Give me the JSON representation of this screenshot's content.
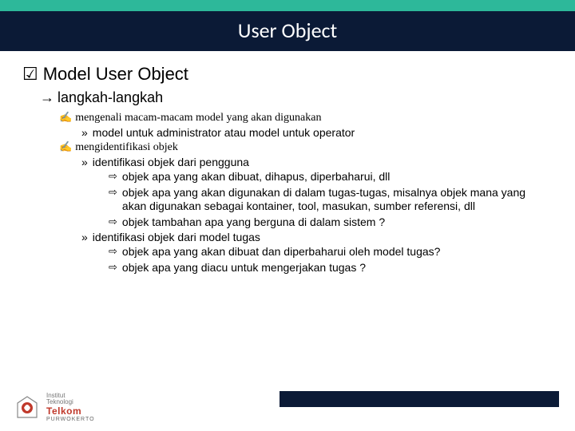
{
  "title": "User Object",
  "l1": {
    "bullet": "☑",
    "text": "Model User Object"
  },
  "l2": {
    "bullet": "→",
    "text": "langkah-langkah"
  },
  "items3": [
    {
      "bullet": "✍",
      "text": "mengenali macam-macam model yang akan digunakan",
      "children4": [
        {
          "bullet": "»",
          "text": "model untuk administrator atau model untuk operator",
          "children5": []
        }
      ]
    },
    {
      "bullet": "✍",
      "text": "mengidentifikasi objek",
      "children4": [
        {
          "bullet": "»",
          "text": "identifikasi objek dari pengguna",
          "children5": [
            {
              "bullet": "⇨",
              "text": "objek apa yang akan dibuat, dihapus, diperbaharui, dll"
            },
            {
              "bullet": "⇨",
              "text": "objek apa yang akan digunakan di dalam tugas-tugas, misalnya objek mana yang akan digunakan sebagai kontainer, tool, masukan, sumber referensi, dll"
            },
            {
              "bullet": "⇨",
              "text": "objek tambahan apa yang berguna di dalam sistem ?"
            }
          ]
        },
        {
          "bullet": "»",
          "text": "identifikasi objek dari model tugas",
          "children5": [
            {
              "bullet": "⇨",
              "text": "objek apa yang akan dibuat dan diperbaharui oleh model tugas?"
            },
            {
              "bullet": "⇨",
              "text": "objek apa yang diacu untuk mengerjakan tugas ?"
            }
          ]
        }
      ]
    }
  ],
  "logo": {
    "inst": "Institut",
    "tech": "Teknologi",
    "name": "Telkom",
    "city": "PURWOKERTO"
  }
}
